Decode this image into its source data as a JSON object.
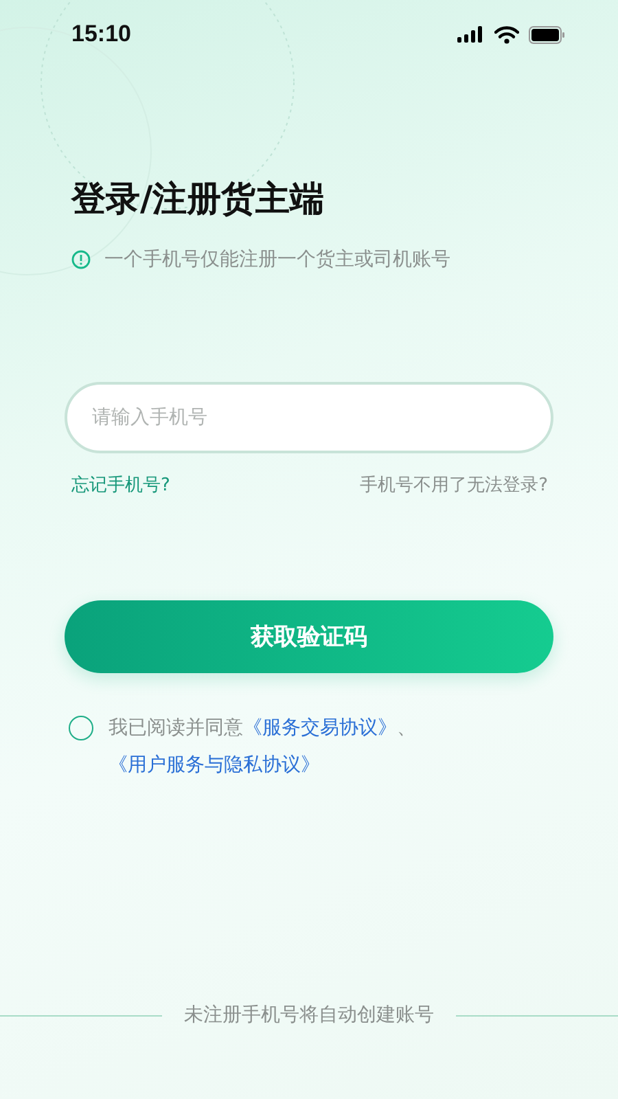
{
  "status_bar": {
    "time": "15:10"
  },
  "title": "登录/注册货主端",
  "notice": "一个手机号仅能注册一个货主或司机账号",
  "phone_field": {
    "placeholder": "请输入手机号"
  },
  "links": [
    {
      "text": "忘记手机号?",
      "kind": "accent"
    },
    {
      "text": "手机号不用了无法登录?",
      "kind": "muted"
    }
  ],
  "submit_button": "获取验证码",
  "agreement": {
    "checked": false,
    "parts": [
      {
        "kind": "text",
        "text": "我已阅读并同意"
      },
      {
        "kind": "link",
        "text": "《服务交易协议》"
      },
      {
        "kind": "text",
        "text": "、"
      },
      {
        "kind": "link",
        "text": "《用户服务与隐私协议》"
      }
    ]
  },
  "footer": "未注册手机号将自动创建账号"
}
